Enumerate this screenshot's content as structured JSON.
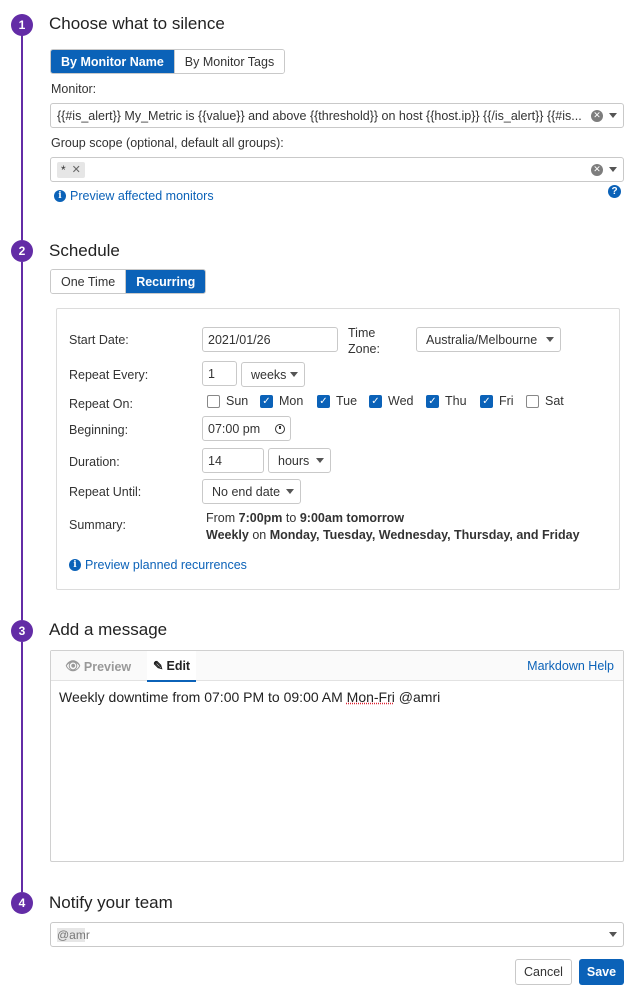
{
  "steps": [
    {
      "num": "1",
      "title": "Choose what to silence"
    },
    {
      "num": "2",
      "title": "Schedule"
    },
    {
      "num": "3",
      "title": "Add a message"
    },
    {
      "num": "4",
      "title": "Notify your team"
    }
  ],
  "silence": {
    "tabs": [
      "By Monitor Name",
      "By Monitor Tags"
    ],
    "active_tab": "By Monitor Name",
    "monitor_label": "Monitor:",
    "monitor_value": "{{#is_alert}} My_Metric is {{value}} and above {{threshold}} on host {{host.ip}} {{/is_alert}} {{#is...",
    "group_scope_label": "Group scope (optional, default all groups):",
    "group_scope_tag": "*",
    "preview_link": "Preview affected monitors",
    "help_icon": "?"
  },
  "schedule": {
    "tabs": [
      "One Time",
      "Recurring"
    ],
    "active_tab": "Recurring",
    "start_date_label": "Start Date:",
    "start_date_value": "2021/01/26",
    "timezone_label_1": "Time",
    "timezone_label_2": "Zone:",
    "timezone_value": "Australia/Melbourne",
    "repeat_every_label": "Repeat Every:",
    "repeat_every_value": "1",
    "repeat_every_unit": "weeks",
    "repeat_on_label": "Repeat On:",
    "days": [
      {
        "name": "Sun",
        "checked": false
      },
      {
        "name": "Mon",
        "checked": true
      },
      {
        "name": "Tue",
        "checked": true
      },
      {
        "name": "Wed",
        "checked": true
      },
      {
        "name": "Thu",
        "checked": true
      },
      {
        "name": "Fri",
        "checked": true
      },
      {
        "name": "Sat",
        "checked": false
      }
    ],
    "beginning_label": "Beginning:",
    "beginning_value": "07:00 pm",
    "duration_label": "Duration:",
    "duration_value": "14",
    "duration_unit": "hours",
    "repeat_until_label": "Repeat Until:",
    "repeat_until_value": "No end date",
    "summary_label": "Summary:",
    "summary_line1": {
      "from": "From",
      "start": "7:00pm",
      "to": "to",
      "end": "9:00am tomorrow"
    },
    "summary_line2": {
      "freq": "Weekly",
      "on": "on",
      "days": "Monday, Tuesday, Wednesday, Thursday, and Friday"
    },
    "preview_link": "Preview planned recurrences"
  },
  "message": {
    "tab_preview": "Preview",
    "tab_edit": "Edit",
    "markdown_help": "Markdown Help",
    "text_before": "Weekly downtime from 07:00 PM to 09:00 AM ",
    "text_misspelled": "Mon-Fri",
    "text_after": " @amri"
  },
  "notify": {
    "value": "@amr"
  },
  "actions": {
    "cancel": "Cancel",
    "save": "Save"
  },
  "colors": {
    "accent": "#632ca6",
    "primary": "#0b62b8"
  }
}
